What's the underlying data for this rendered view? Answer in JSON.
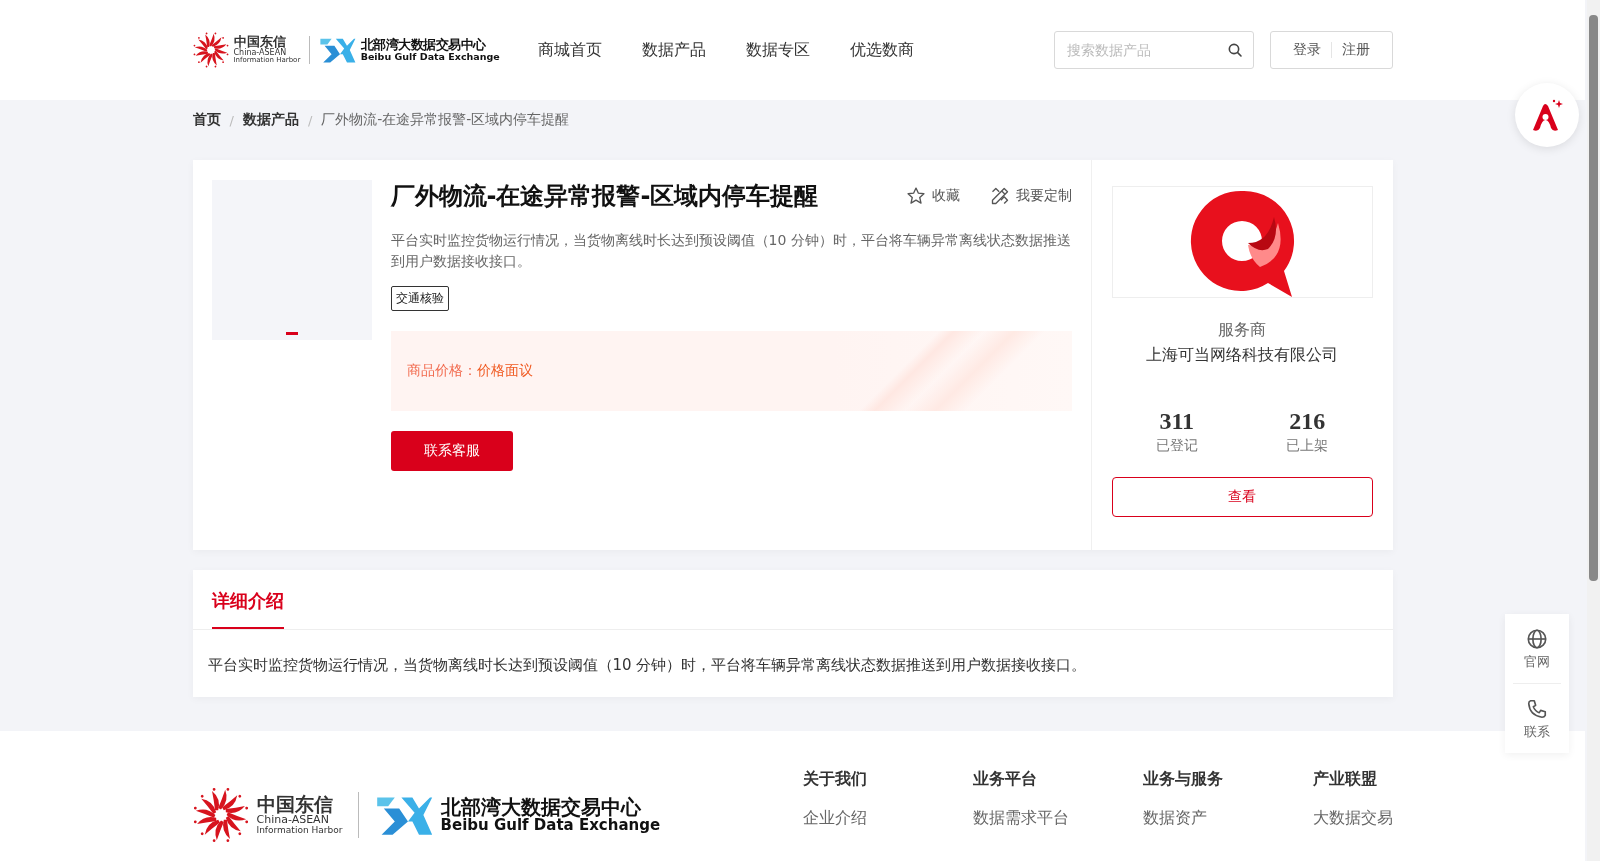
{
  "header": {
    "logo": {
      "cn": "中国东信",
      "en1": "China-ASEAN",
      "en2": "Information Harbor",
      "exchange_cn": "北部湾大数据交易中心",
      "exchange_en": "Beibu Gulf Data Exchange"
    },
    "nav": [
      "商城首页",
      "数据产品",
      "数据专区",
      "优选数商"
    ],
    "search": {
      "placeholder": "搜索数据产品"
    },
    "auth": [
      "登录",
      "注册"
    ]
  },
  "breadcrumb": {
    "separator": "/",
    "items": [
      "首页",
      "数据产品",
      "厂外物流-在途异常报警-区域内停车提醒"
    ]
  },
  "product": {
    "title": "厂外物流-在途异常报警-区域内停车提醒",
    "actions": [
      {
        "kind": "favorite",
        "label": "收藏"
      },
      {
        "kind": "customize",
        "label": "我要定制"
      }
    ],
    "description": "平台实时监控货物运行情况，当货物离线时长达到预设阈值（10 分钟）时，平台将车辆异常离线状态数据推送到用户数据接收接口。",
    "tags": [
      "交通核验"
    ],
    "price_label": "商品价格：",
    "price_value": "价格面议",
    "contact_button": "联系客服"
  },
  "provider": {
    "role": "服务商",
    "name": "上海可当网络科技有限公司",
    "stats": [
      {
        "value": "311",
        "label": "已登记"
      },
      {
        "value": "216",
        "label": "已上架"
      }
    ],
    "view_button": "查看"
  },
  "detail": {
    "tabs": [
      {
        "label": "详细介绍",
        "selected": true
      }
    ],
    "text": "平台实时监控货物运行情况，当货物离线时长达到预设阈值（10 分钟）时，平台将车辆异常离线状态数据推送到用户数据接收接口。"
  },
  "footer": {
    "logo": {
      "cn": "中国东信",
      "en1": "China-ASEAN",
      "en2": "Information Harbor",
      "exchange_cn": "北部湾大数据交易中心",
      "exchange_en": "Beibu Gulf Data Exchange"
    },
    "columns": [
      {
        "title": "关于我们",
        "links": [
          "企业介绍"
        ]
      },
      {
        "title": "业务平台",
        "links": [
          "数据需求平台"
        ]
      },
      {
        "title": "业务与服务",
        "links": [
          "数据资产"
        ]
      },
      {
        "title": "产业联盟",
        "links": [
          "大数据交易"
        ]
      }
    ]
  },
  "side_panel": [
    {
      "kind": "globe",
      "label": "官网"
    },
    {
      "kind": "phone",
      "label": "联系"
    }
  ]
}
